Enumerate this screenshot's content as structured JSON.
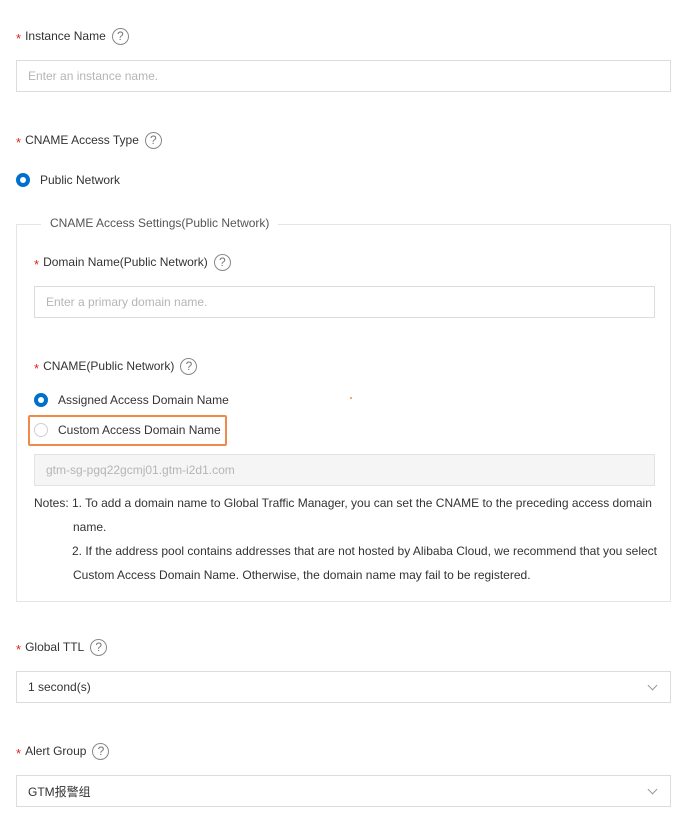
{
  "instance_name": {
    "label": "Instance Name",
    "placeholder": "Enter an instance name."
  },
  "cname_access_type": {
    "label": "CNAME Access Type",
    "options": [
      {
        "label": "Public Network",
        "checked": true
      }
    ]
  },
  "cname_settings": {
    "legend": "CNAME Access Settings(Public Network)",
    "domain_name": {
      "label": "Domain Name(Public Network)",
      "placeholder": "Enter a primary domain name."
    },
    "cname": {
      "label": "CNAME(Public Network)",
      "options": [
        {
          "label": "Assigned Access Domain Name",
          "checked": true
        },
        {
          "label": "Custom Access Domain Name",
          "checked": false
        }
      ],
      "assigned_value": "gtm-sg-pgq22gcmj01.gtm-i2d1.com"
    },
    "notes": {
      "prefix": "Notes:",
      "lines": [
        "1. To add a domain name to Global Traffic Manager, you can set the CNAME to the preceding access domain",
        "name.",
        "2. If the address pool contains addresses that are not hosted by Alibaba Cloud, we recommend that you select",
        "Custom Access Domain Name. Otherwise, the domain name may fail to be registered."
      ]
    }
  },
  "global_ttl": {
    "label": "Global TTL",
    "value": "1 second(s)"
  },
  "alert_group": {
    "label": "Alert Group",
    "value": "GTM报警组"
  },
  "icons": {
    "help": "question-circle-icon",
    "dropdown": "chevron-down-icon"
  },
  "colors": {
    "required": "#e2231a",
    "accent": "#0070cc",
    "highlight": "#f08a4b"
  }
}
